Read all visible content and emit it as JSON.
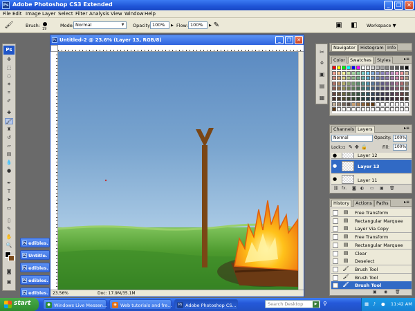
{
  "app": {
    "title": "Adobe Photoshop CS3 Extended",
    "logo": "Ps",
    "minimize": "_",
    "restore": "❐",
    "close": "✕"
  },
  "menu": [
    "File",
    "Edit",
    "Image",
    "Layer",
    "Select",
    "Filter",
    "Analysis",
    "View",
    "Window",
    "Help"
  ],
  "options": {
    "brush_label": "Brush:",
    "brush_size": "19",
    "mode_label": "Mode:",
    "mode_value": "Normal",
    "opacity_label": "Opacity:",
    "opacity_value": "100%",
    "flow_label": "Flow:",
    "flow_value": "100%",
    "workspace_label": "Workspace ▼"
  },
  "minimized_docs": [
    "edibles.",
    "Untitle.",
    "edibles.",
    "edibles.",
    "edibles."
  ],
  "document": {
    "title": "Untitled-2 @ 23.6% (Layer 13, RGB/8)",
    "zoom": "23.56%",
    "doc_size": "Doc: 17.9M/35.1M"
  },
  "navigator_panel": {
    "tabs": [
      "Navigator",
      "Histogram",
      "Info"
    ],
    "menu": "▸≡"
  },
  "swatches_panel": {
    "tabs": [
      "Color",
      "Swatches",
      "Styles"
    ],
    "menu": "▸≡"
  },
  "layers_panel": {
    "tabs": [
      "Channels",
      "Layers"
    ],
    "blend_mode": "Normal",
    "opacity_label": "Opacity:",
    "opacity_value": "100%",
    "lock_label": "Lock:",
    "fill_label": "Fill:",
    "fill_value": "100%",
    "layers": [
      {
        "name": "Layer 12",
        "selected": false
      },
      {
        "name": "Layer 13",
        "selected": true
      },
      {
        "name": "Layer 11",
        "selected": false
      }
    ],
    "footer": "fx."
  },
  "history_panel": {
    "tabs": [
      "History",
      "Actions",
      "Paths"
    ],
    "items": [
      {
        "label": "Free Transform",
        "icon": "transform-icon",
        "selected": false
      },
      {
        "label": "Rectangular Marquee",
        "icon": "marquee-icon",
        "selected": false
      },
      {
        "label": "Layer Via Copy",
        "icon": "layer-copy-icon",
        "selected": false
      },
      {
        "label": "Free Transform",
        "icon": "transform-icon",
        "selected": false
      },
      {
        "label": "Rectangular Marquee",
        "icon": "marquee-icon",
        "selected": false
      },
      {
        "label": "Clear",
        "icon": "clear-icon",
        "selected": false
      },
      {
        "label": "Deselect",
        "icon": "deselect-icon",
        "selected": false
      },
      {
        "label": "Brush Tool",
        "icon": "brush-icon",
        "selected": false
      },
      {
        "label": "Brush Tool",
        "icon": "brush-icon",
        "selected": false
      },
      {
        "label": "Brush Tool",
        "icon": "brush-icon",
        "selected": true
      }
    ]
  },
  "taskbar": {
    "start": "start",
    "buttons": [
      {
        "label": "Windows Live Messen...",
        "icon": "messenger-icon",
        "color": "#2b8a3e",
        "active": false
      },
      {
        "label": "Web tutorials and fre...",
        "icon": "firefox-icon",
        "color": "#e0701b",
        "active": false
      },
      {
        "label": "Adobe Photoshop CS...",
        "icon": "photoshop-icon",
        "color": "#1c3f8e",
        "active": true
      }
    ],
    "search_placeholder": "Search Desktop",
    "clock": "11:42 AM"
  },
  "colors": {
    "foreground": "#000000",
    "background": "#7a4a1a",
    "selection": "#316ac5"
  }
}
